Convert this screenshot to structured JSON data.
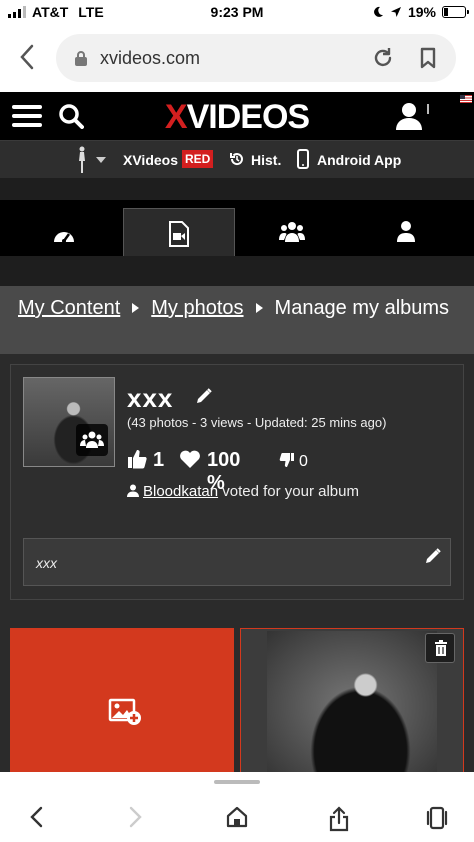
{
  "status_bar": {
    "carrier": "AT&T",
    "network": "LTE",
    "time": "9:23 PM",
    "battery": "19%",
    "battery_level": 0.19
  },
  "browser": {
    "url": "xvideos.com"
  },
  "header": {
    "logo_x": "X",
    "logo_rest": "VIDEOS"
  },
  "subnav": {
    "xvideos_label": "XVideos",
    "red_badge": "RED",
    "history_label": "Hist.",
    "android_label": "Android App"
  },
  "breadcrumb": {
    "items": [
      "My Content",
      "My photos",
      "Manage my albums"
    ]
  },
  "album": {
    "title": "xxx",
    "meta": "(43 photos - 3 views - Updated: 25 mins ago)",
    "likes": "1",
    "rating": "100 %",
    "dislikes": "0",
    "voter": "Bloodkatan",
    "voted_text": "voted for your album",
    "description": "xxx"
  },
  "icons": [
    "hamburger-icon",
    "search-icon",
    "user-icon",
    "history-icon",
    "phone-icon",
    "dashboard-icon",
    "video-file-icon",
    "group-icon",
    "profile-icon",
    "edit-icon",
    "thumbs-up-icon",
    "heart-icon",
    "thumbs-down-icon",
    "add-image-icon",
    "trash-icon"
  ],
  "colors": {
    "brand_red": "#d31f1f",
    "add_tile": "#d3391e",
    "header_bg": "#000000"
  }
}
